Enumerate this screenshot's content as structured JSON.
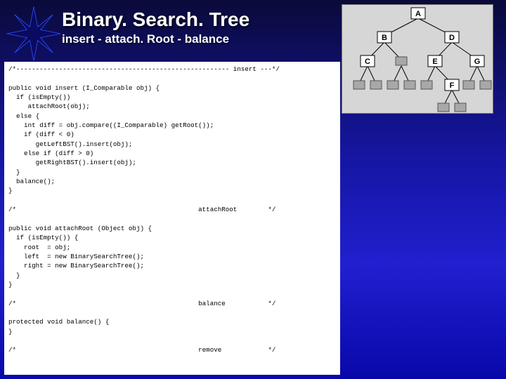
{
  "header": {
    "title": "Binary. Search. Tree",
    "subtitle": "insert - attach. Root - balance"
  },
  "tree": {
    "nodes": {
      "A": "A",
      "B": "B",
      "C": "C",
      "D": "D",
      "E": "E",
      "F": "F",
      "G": "G"
    }
  },
  "code": {
    "line01": "/*------------------------------------------------------- insert ---*/",
    "line02": "",
    "line03": "public void insert (I_Comparable obj) {",
    "line04": "  if (isEmpty())",
    "line05": "     attachRoot(obj);",
    "line06": "  else {",
    "line07": "    int diff = obj.compare((I_Comparable) getRoot());",
    "line08": "    if (diff < 0)",
    "line09": "       getLeftBST().insert(obj);",
    "line10": "    else if (diff > 0)",
    "line11": "       getRightBST().insert(obj);",
    "line12": "  }",
    "line13": "  balance();",
    "line14": "}",
    "line15": "",
    "line16": "/*                                               attachRoot        */",
    "line17": "",
    "line18": "public void attachRoot (Object obj) {",
    "line19": "  if (isEmpty()) {",
    "line20": "    root  = obj;",
    "line21": "    left  = new BinarySearchTree();",
    "line22": "    right = new BinarySearchTree();",
    "line23": "  }",
    "line24": "}",
    "line25": "",
    "line26": "/*                                               balance           */",
    "line27": "",
    "line28": "protected void balance() {",
    "line29": "}",
    "line30": "",
    "line31": "/*                                               remove            */"
  }
}
